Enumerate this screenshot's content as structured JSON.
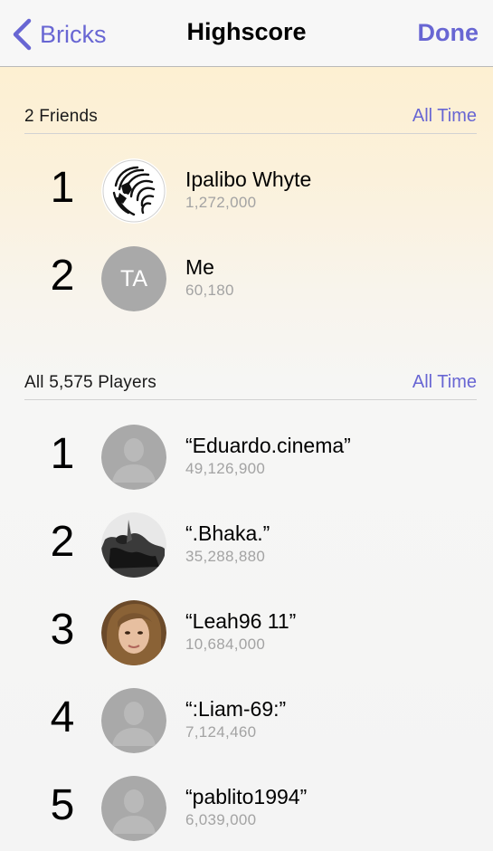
{
  "navbar": {
    "back_label": "Bricks",
    "title": "Highscore",
    "done_label": "Done"
  },
  "friends_section": {
    "title": "2 Friends",
    "filter": "All Time",
    "rows": [
      {
        "rank": "1",
        "name": "Ipalibo Whyte",
        "score": "1,272,000",
        "avatar": "lion-logo-avatar"
      },
      {
        "rank": "2",
        "name": "Me",
        "score": "60,180",
        "avatar": "initials-avatar",
        "initials": "TA"
      }
    ]
  },
  "players_section": {
    "title": "All 5,575 Players",
    "filter": "All Time",
    "rows": [
      {
        "rank": "1",
        "name": "“Eduardo.cinema”",
        "score": "49,126,900",
        "avatar": "placeholder-person-avatar"
      },
      {
        "rank": "2",
        "name": "“.Bhaka.”",
        "score": "35,288,880",
        "avatar": "photo-avatar-dark"
      },
      {
        "rank": "3",
        "name": "“Leah96 11”",
        "score": "10,684,000",
        "avatar": "photo-avatar-woman"
      },
      {
        "rank": "4",
        "name": "“:Liam-69:”",
        "score": "7,124,460",
        "avatar": "placeholder-person-avatar"
      },
      {
        "rank": "5",
        "name": "“pablito1994”",
        "score": "6,039,000",
        "avatar": "placeholder-person-avatar"
      }
    ]
  },
  "colors": {
    "accent": "#6866d3",
    "score_text": "#a3a3a3",
    "avatar_placeholder": "#a9a9a9"
  }
}
